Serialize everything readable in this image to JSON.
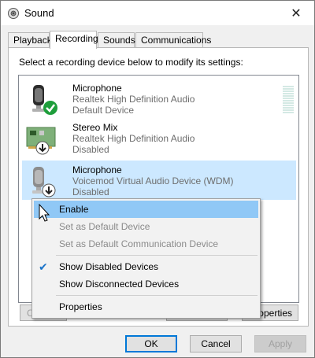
{
  "window": {
    "title": "Sound",
    "close_glyph": "✕"
  },
  "tabs": [
    {
      "label": "Playback",
      "active": false
    },
    {
      "label": "Recording",
      "active": true
    },
    {
      "label": "Sounds",
      "active": false
    },
    {
      "label": "Communications",
      "active": false
    }
  ],
  "instruction": "Select a recording device below to modify its settings:",
  "devices": [
    {
      "name": "Microphone",
      "driver": "Realtek High Definition Audio",
      "status": "Default Device",
      "icon": "microphone-icon",
      "badge": "default-check-badge"
    },
    {
      "name": "Stereo Mix",
      "driver": "Realtek High Definition Audio",
      "status": "Disabled",
      "icon": "sound-card-icon",
      "badge": "disabled-arrow-badge"
    },
    {
      "name": "Microphone",
      "driver": "Voicemod Virtual Audio Device (WDM)",
      "status": "Disabled",
      "icon": "microphone-icon",
      "badge": "disabled-arrow-badge",
      "selected": true
    }
  ],
  "context_menu": {
    "items": [
      {
        "label": "Enable",
        "state": "highlighted"
      },
      {
        "label": "Set as Default Device",
        "state": "disabled"
      },
      {
        "label": "Set as Default Communication Device",
        "state": "disabled"
      },
      {
        "label": "Show Disabled Devices",
        "checked": true
      },
      {
        "label": "Show Disconnected Devices"
      },
      {
        "label": "Properties"
      }
    ]
  },
  "panel_buttons": {
    "left_partial": "C",
    "right_partial": "operties"
  },
  "buttons": {
    "ok": "OK",
    "cancel": "Cancel",
    "apply": "Apply"
  },
  "colors": {
    "selection": "#cce8ff",
    "menu_highlight": "#90c8f6",
    "default_check": "#1e9e3b",
    "accent": "#0078d7"
  }
}
